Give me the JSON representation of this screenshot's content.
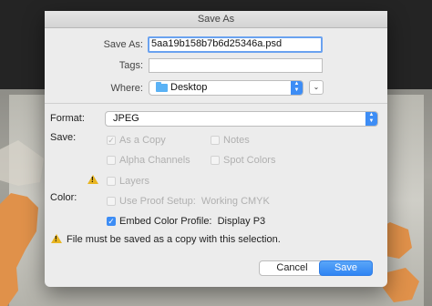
{
  "dialog": {
    "title": "Save As",
    "save_as_label": "Save As:",
    "filename": "5aa19b158b7b6d25346a.psd",
    "tags_label": "Tags:",
    "tags_value": "",
    "where_label": "Where:",
    "where_value": "Desktop",
    "where_icon": "folder-icon",
    "expand_icon": "chevron-down-icon"
  },
  "format": {
    "label": "Format:",
    "value": "JPEG"
  },
  "save_options": {
    "label": "Save:",
    "as_a_copy": {
      "label": "As a Copy",
      "checked": true,
      "enabled": false
    },
    "notes": {
      "label": "Notes",
      "checked": false,
      "enabled": false
    },
    "alpha_channels": {
      "label": "Alpha Channels",
      "checked": false,
      "enabled": false
    },
    "spot_colors": {
      "label": "Spot Colors",
      "checked": false,
      "enabled": false
    },
    "layers": {
      "label": "Layers",
      "checked": false,
      "enabled": false
    }
  },
  "color_options": {
    "label": "Color:",
    "use_proof_setup": {
      "label": "Use Proof Setup:  Working CMYK",
      "checked": false,
      "enabled": false
    },
    "embed_color_profile": {
      "label": "Embed Color Profile:  Display P3",
      "checked": true,
      "enabled": true
    }
  },
  "warning": {
    "message": "File must be saved as a copy with this selection."
  },
  "buttons": {
    "cancel": "Cancel",
    "save": "Save"
  },
  "colors": {
    "accent": "#3d8df5",
    "warning": "#e8b521"
  }
}
